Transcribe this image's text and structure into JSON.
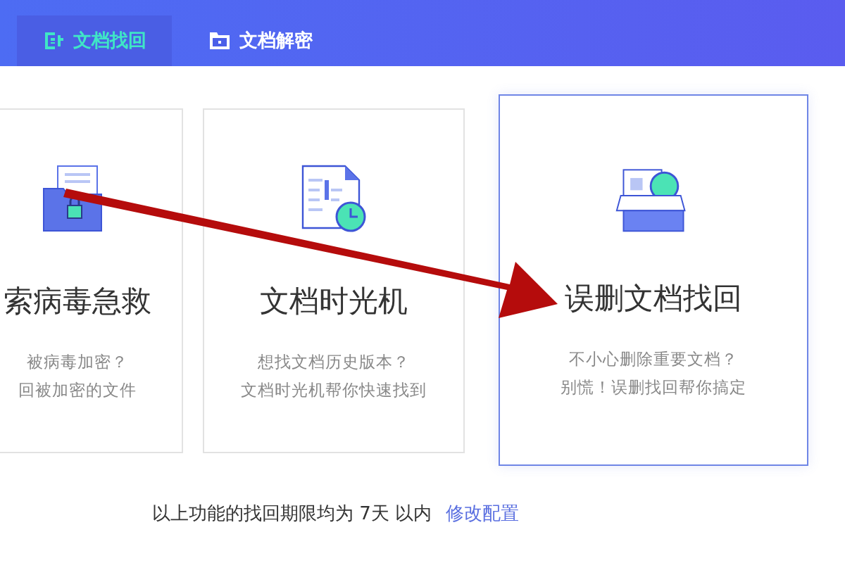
{
  "tabs": [
    {
      "label": "文档找回",
      "selected": true,
      "kind": "recover"
    },
    {
      "label": "文档解密",
      "selected": false,
      "kind": "decrypt"
    }
  ],
  "cards": [
    {
      "kind": "ransom",
      "title": "索病毒急救",
      "lines": [
        "被病毒加密？",
        "回被加密的文件"
      ],
      "selected": false
    },
    {
      "kind": "timemachine",
      "title": "文档时光机",
      "lines": [
        "想找文档历史版本？",
        "文档时光机帮你快速找到"
      ],
      "selected": false
    },
    {
      "kind": "deleted",
      "title": "误删文档找回",
      "lines": [
        "不小心删除重要文档？",
        "别慌！误删找回帮你搞定"
      ],
      "selected": true
    }
  ],
  "footer": {
    "text": "以上功能的找回期限均为 7天 以内",
    "link": "修改配置"
  }
}
